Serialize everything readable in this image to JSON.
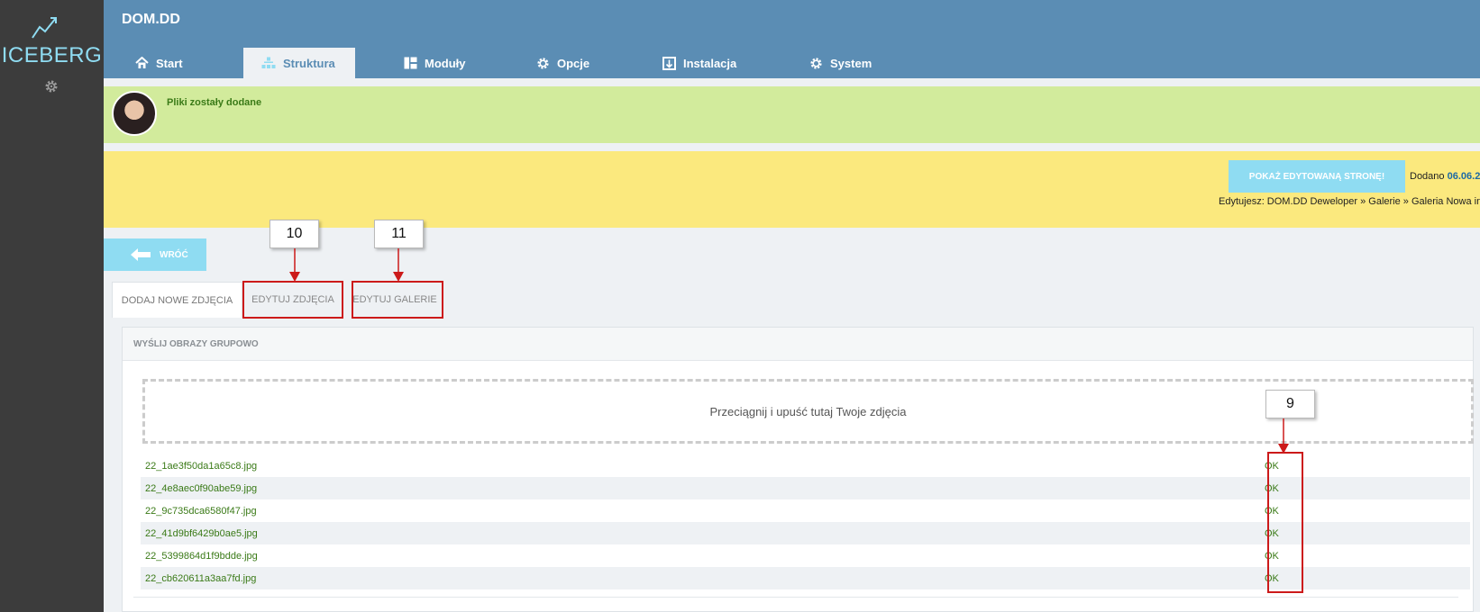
{
  "app": {
    "name": "ICEBERG"
  },
  "header": {
    "site_title": "DOM.DD",
    "tabs": [
      {
        "label": "Start",
        "icon": "home-icon"
      },
      {
        "label": "Struktura",
        "icon": "sitemap-icon",
        "active": true
      },
      {
        "label": "Moduły",
        "icon": "modules-icon"
      },
      {
        "label": "Opcje",
        "icon": "gear-icon"
      },
      {
        "label": "Instalacja",
        "icon": "install-icon"
      },
      {
        "label": "System",
        "icon": "gear-icon"
      }
    ]
  },
  "notice": {
    "text": "Pliki zostały dodane"
  },
  "edit_bar": {
    "show_button": "POKAŻ EDYTOWANĄ STRONĘ!",
    "added_label": "Dodano",
    "added_date": "06.06.2",
    "editing_text": "Edytujesz: DOM.DD Deweloper » Galerie » Galeria Nowa inw"
  },
  "back_button": "WRÓĆ",
  "page_tabs": [
    {
      "label": "DODAJ NOWE ZDJĘCIA",
      "active": true
    },
    {
      "label": "EDYTUJ ZDJĘCIA"
    },
    {
      "label": "EDYTUJ GALERIE"
    }
  ],
  "callouts": [
    "10",
    "11",
    "9"
  ],
  "upload_panel": {
    "title": "WYŚLIJ OBRAZY GRUPOWO",
    "dropzone_text": "Przeciągnij i upuść tutaj Twoje zdjęcia",
    "files": [
      {
        "name": "22_1ae3f50da1a65c8.jpg",
        "status": "OK"
      },
      {
        "name": "22_4e8aec0f90abe59.jpg",
        "status": "OK"
      },
      {
        "name": "22_9c735dca6580f47.jpg",
        "status": "OK"
      },
      {
        "name": "22_41d9bf6429b0ae5.jpg",
        "status": "OK"
      },
      {
        "name": "22_5399864d1f9bdde.jpg",
        "status": "OK"
      },
      {
        "name": "22_cb620611a3aa7fd.jpg",
        "status": "OK"
      }
    ]
  },
  "colors": {
    "sidebar": "#3c3c3c",
    "header": "#5b8db4",
    "accent": "#8fdcf2",
    "notice_bg": "#d2eb9c",
    "notice_text": "#3a7a17",
    "edit_bar_bg": "#fbe97e",
    "callout_border": "#cc1a1a"
  }
}
